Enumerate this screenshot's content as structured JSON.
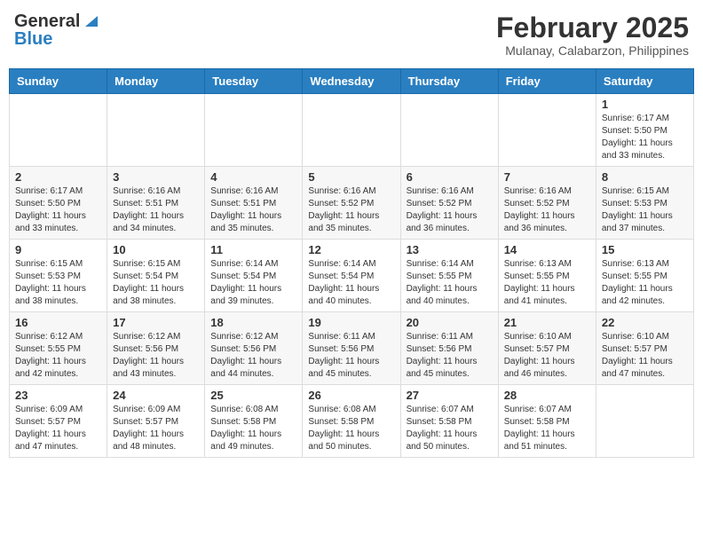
{
  "header": {
    "logo_general": "General",
    "logo_blue": "Blue",
    "month_title": "February 2025",
    "location": "Mulanay, Calabarzon, Philippines"
  },
  "calendar": {
    "days_of_week": [
      "Sunday",
      "Monday",
      "Tuesday",
      "Wednesday",
      "Thursday",
      "Friday",
      "Saturday"
    ],
    "weeks": [
      [
        {
          "day": "",
          "info": ""
        },
        {
          "day": "",
          "info": ""
        },
        {
          "day": "",
          "info": ""
        },
        {
          "day": "",
          "info": ""
        },
        {
          "day": "",
          "info": ""
        },
        {
          "day": "",
          "info": ""
        },
        {
          "day": "1",
          "info": "Sunrise: 6:17 AM\nSunset: 5:50 PM\nDaylight: 11 hours and 33 minutes."
        }
      ],
      [
        {
          "day": "2",
          "info": "Sunrise: 6:17 AM\nSunset: 5:50 PM\nDaylight: 11 hours and 33 minutes."
        },
        {
          "day": "3",
          "info": "Sunrise: 6:16 AM\nSunset: 5:51 PM\nDaylight: 11 hours and 34 minutes."
        },
        {
          "day": "4",
          "info": "Sunrise: 6:16 AM\nSunset: 5:51 PM\nDaylight: 11 hours and 35 minutes."
        },
        {
          "day": "5",
          "info": "Sunrise: 6:16 AM\nSunset: 5:52 PM\nDaylight: 11 hours and 35 minutes."
        },
        {
          "day": "6",
          "info": "Sunrise: 6:16 AM\nSunset: 5:52 PM\nDaylight: 11 hours and 36 minutes."
        },
        {
          "day": "7",
          "info": "Sunrise: 6:16 AM\nSunset: 5:52 PM\nDaylight: 11 hours and 36 minutes."
        },
        {
          "day": "8",
          "info": "Sunrise: 6:15 AM\nSunset: 5:53 PM\nDaylight: 11 hours and 37 minutes."
        }
      ],
      [
        {
          "day": "9",
          "info": "Sunrise: 6:15 AM\nSunset: 5:53 PM\nDaylight: 11 hours and 38 minutes."
        },
        {
          "day": "10",
          "info": "Sunrise: 6:15 AM\nSunset: 5:54 PM\nDaylight: 11 hours and 38 minutes."
        },
        {
          "day": "11",
          "info": "Sunrise: 6:14 AM\nSunset: 5:54 PM\nDaylight: 11 hours and 39 minutes."
        },
        {
          "day": "12",
          "info": "Sunrise: 6:14 AM\nSunset: 5:54 PM\nDaylight: 11 hours and 40 minutes."
        },
        {
          "day": "13",
          "info": "Sunrise: 6:14 AM\nSunset: 5:55 PM\nDaylight: 11 hours and 40 minutes."
        },
        {
          "day": "14",
          "info": "Sunrise: 6:13 AM\nSunset: 5:55 PM\nDaylight: 11 hours and 41 minutes."
        },
        {
          "day": "15",
          "info": "Sunrise: 6:13 AM\nSunset: 5:55 PM\nDaylight: 11 hours and 42 minutes."
        }
      ],
      [
        {
          "day": "16",
          "info": "Sunrise: 6:12 AM\nSunset: 5:55 PM\nDaylight: 11 hours and 42 minutes."
        },
        {
          "day": "17",
          "info": "Sunrise: 6:12 AM\nSunset: 5:56 PM\nDaylight: 11 hours and 43 minutes."
        },
        {
          "day": "18",
          "info": "Sunrise: 6:12 AM\nSunset: 5:56 PM\nDaylight: 11 hours and 44 minutes."
        },
        {
          "day": "19",
          "info": "Sunrise: 6:11 AM\nSunset: 5:56 PM\nDaylight: 11 hours and 45 minutes."
        },
        {
          "day": "20",
          "info": "Sunrise: 6:11 AM\nSunset: 5:56 PM\nDaylight: 11 hours and 45 minutes."
        },
        {
          "day": "21",
          "info": "Sunrise: 6:10 AM\nSunset: 5:57 PM\nDaylight: 11 hours and 46 minutes."
        },
        {
          "day": "22",
          "info": "Sunrise: 6:10 AM\nSunset: 5:57 PM\nDaylight: 11 hours and 47 minutes."
        }
      ],
      [
        {
          "day": "23",
          "info": "Sunrise: 6:09 AM\nSunset: 5:57 PM\nDaylight: 11 hours and 47 minutes."
        },
        {
          "day": "24",
          "info": "Sunrise: 6:09 AM\nSunset: 5:57 PM\nDaylight: 11 hours and 48 minutes."
        },
        {
          "day": "25",
          "info": "Sunrise: 6:08 AM\nSunset: 5:58 PM\nDaylight: 11 hours and 49 minutes."
        },
        {
          "day": "26",
          "info": "Sunrise: 6:08 AM\nSunset: 5:58 PM\nDaylight: 11 hours and 50 minutes."
        },
        {
          "day": "27",
          "info": "Sunrise: 6:07 AM\nSunset: 5:58 PM\nDaylight: 11 hours and 50 minutes."
        },
        {
          "day": "28",
          "info": "Sunrise: 6:07 AM\nSunset: 5:58 PM\nDaylight: 11 hours and 51 minutes."
        },
        {
          "day": "",
          "info": ""
        }
      ]
    ]
  }
}
